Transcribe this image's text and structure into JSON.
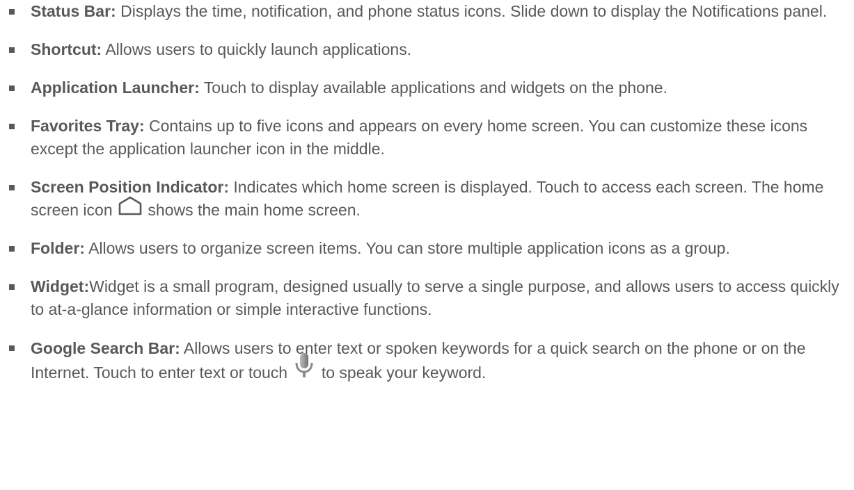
{
  "items": [
    {
      "term": "Status Bar:",
      "desc": " Displays the time, notification, and phone status icons. Slide down to display the Notifications panel."
    },
    {
      "term": "Shortcut:",
      "desc": " Allows users to quickly launch applications."
    },
    {
      "term": "Application Launcher:",
      "desc": " Touch to display available applications and widgets on the phone."
    },
    {
      "term": "Favorites Tray:",
      "desc": " Contains up to five icons and appears on every home screen. You can customize these icons except the application launcher icon in the middle."
    },
    {
      "term": "Screen Position Indicator:",
      "desc_before": " Indicates which home screen is displayed. Touch to access each screen. The home screen icon ",
      "desc_after": " shows the main home screen."
    },
    {
      "term": "Folder:",
      "desc": " Allows users to organize screen items. You can store multiple application icons as a group."
    },
    {
      "term": "Widget:",
      "desc": "Widget is a small program, designed usually to serve a single purpose, and allows users to access quickly to at-a-glance information or simple interactive functions."
    },
    {
      "term": "Google Search Bar:",
      "desc_before": " Allows users to enter text or spoken keywords for a quick search on the phone or on the Internet. Touch to enter text or touch ",
      "desc_after": " to speak your keyword."
    }
  ],
  "icons": {
    "bullet": "square-bullet-icon",
    "home": "home-outline-icon",
    "mic": "microphone-icon"
  },
  "colors": {
    "text": "#595959",
    "icon": "#888888"
  }
}
